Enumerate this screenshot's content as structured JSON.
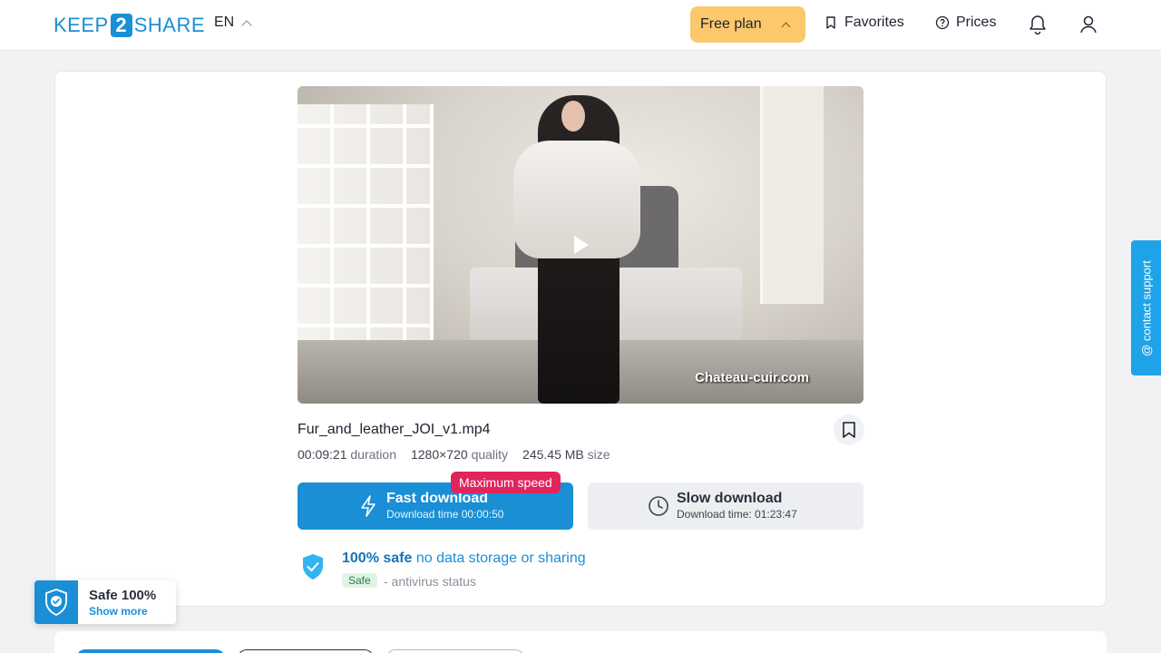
{
  "header": {
    "logo_left": "KEEP",
    "logo_mid": "2",
    "logo_right": "SHARE",
    "language": "EN",
    "free_plan": "Free plan",
    "favorites": "Favorites",
    "prices": "Prices"
  },
  "file": {
    "watermark": "Chateau-cuir.com",
    "name": "Fur_and_leather_JOI_v1.mp4",
    "duration_value": "00:09:21",
    "duration_label": "duration",
    "quality_value": "1280×720",
    "quality_label": "quality",
    "size_value": "245.45 MB",
    "size_label": "size"
  },
  "download": {
    "badge": "Maximum speed",
    "fast_title": "Fast download",
    "fast_sub": "Download time 00:00:50",
    "slow_title": "Slow download",
    "slow_sub": "Download time: 01:23:47"
  },
  "safety": {
    "title_bold": "100% safe",
    "title_rest": "no data storage or sharing",
    "badge": "Safe",
    "status": "- antivirus status"
  },
  "widget": {
    "title": "Safe 100%",
    "link": "Show more"
  },
  "contact": {
    "label": "@ contact support"
  },
  "colors": {
    "accent": "#1a8fd6",
    "free_plan": "#fcc86b",
    "badge": "#e1245c"
  }
}
